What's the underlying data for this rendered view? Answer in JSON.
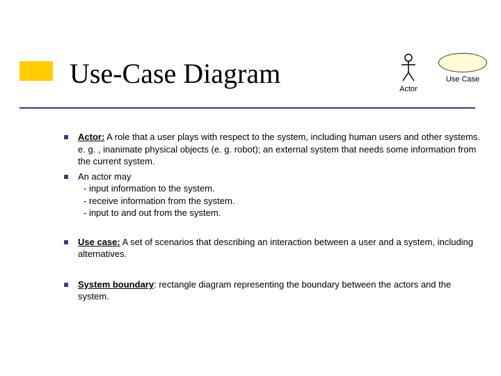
{
  "title": "Use-Case Diagram",
  "symbols": {
    "actor_label": "Actor",
    "usecase_label": "Use Case"
  },
  "bullets": {
    "b1_term": "Actor:",
    "b1_rest": "  A role that a user plays with respect to the system, including human users and other systems. e. g. , inanimate physical objects (e. g. robot); an external system that needs some information from the current system.",
    "b2_lead": "An actor may",
    "b2_s1": "- input information to the system.",
    "b2_s2": "- receive information from the system.",
    "b2_s3": "- input to and out from the system.",
    "b3_term": "Use case:",
    "b3_rest": " A set of scenarios that describing an interaction  between a user and a system, including alternatives.",
    "b4_term": "System boundary",
    "b4_rest": ": rectangle diagram representing the boundary between the actors and the system."
  }
}
